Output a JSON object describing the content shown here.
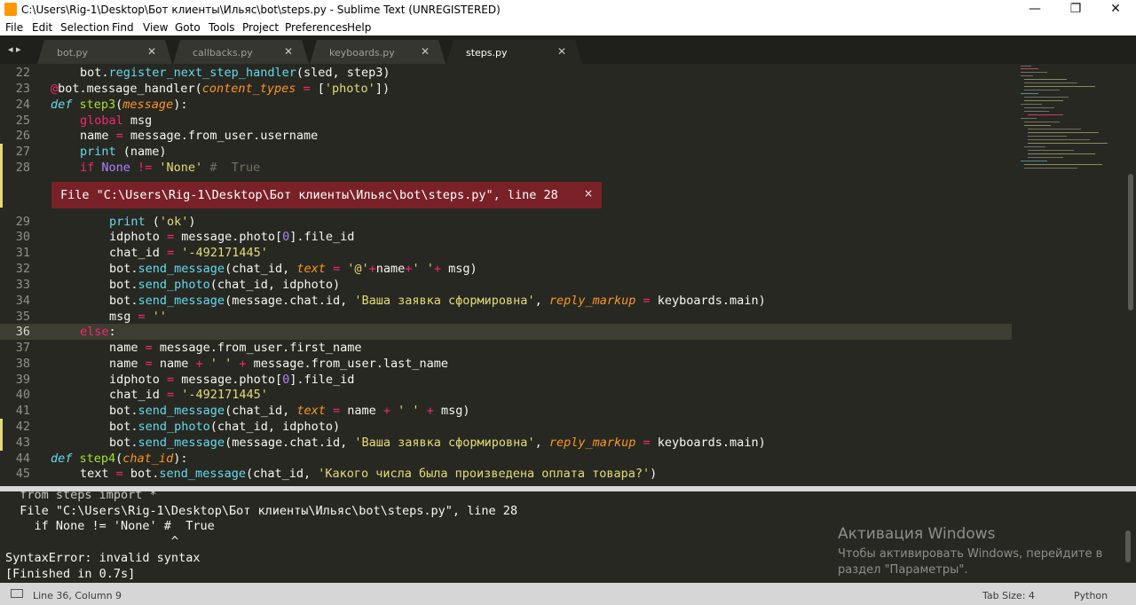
{
  "window": {
    "title": "C:\\Users\\Rig-1\\Desktop\\Бот клиенты\\Ильяс\\bot\\steps.py - Sublime Text (UNREGISTERED)",
    "minimize": "—",
    "maximize": "❐",
    "close": "✕"
  },
  "menu": [
    "File",
    "Edit",
    "Selection",
    "Find",
    "View",
    "Goto",
    "Tools",
    "Project",
    "Preferences",
    "Help"
  ],
  "tabs": [
    {
      "label": "bot.py",
      "active": false
    },
    {
      "label": "callbacks.py",
      "active": false
    },
    {
      "label": "keyboards.py",
      "active": false
    },
    {
      "label": "steps.py",
      "active": true
    }
  ],
  "tab_nav": "◂ ▸",
  "tab_close_glyph": "✕",
  "editor": {
    "line_numbers": [
      "22",
      "23",
      "24",
      "25",
      "26",
      "27",
      "28",
      "29",
      "30",
      "31",
      "32",
      "33",
      "34",
      "35",
      "36",
      "37",
      "38",
      "39",
      "40",
      "41",
      "42",
      "43",
      "44",
      "45"
    ],
    "highlighted_line": "36",
    "error_phantom": "File \"C:\\Users\\Rig-1\\Desktop\\Бот клиенты\\Ильяс\\bot\\steps.py\", line 28",
    "error_close": "×"
  },
  "output": {
    "lines": [
      "  from steps import *",
      "  File \"C:\\Users\\Rig-1\\Desktop\\Бот клиенты\\Ильяс\\bot\\steps.py\", line 28",
      "    if None != 'None' #  True",
      "                       ^",
      "SyntaxError: invalid syntax",
      "[Finished in 0.7s]"
    ]
  },
  "activation": {
    "title": "Активация Windows",
    "line1": "Чтобы активировать Windows, перейдите в",
    "line2": "раздел \"Параметры\"."
  },
  "status": {
    "position": "Line 36, Column 9",
    "tab_size": "Tab Size: 4",
    "syntax": "Python"
  },
  "colors": {
    "background": "#272822",
    "keyword": "#f92672",
    "function": "#66d9ef",
    "string": "#e6db74",
    "number": "#ae81ff",
    "argument": "#fd971f",
    "error_phantom": "#7a2128"
  }
}
